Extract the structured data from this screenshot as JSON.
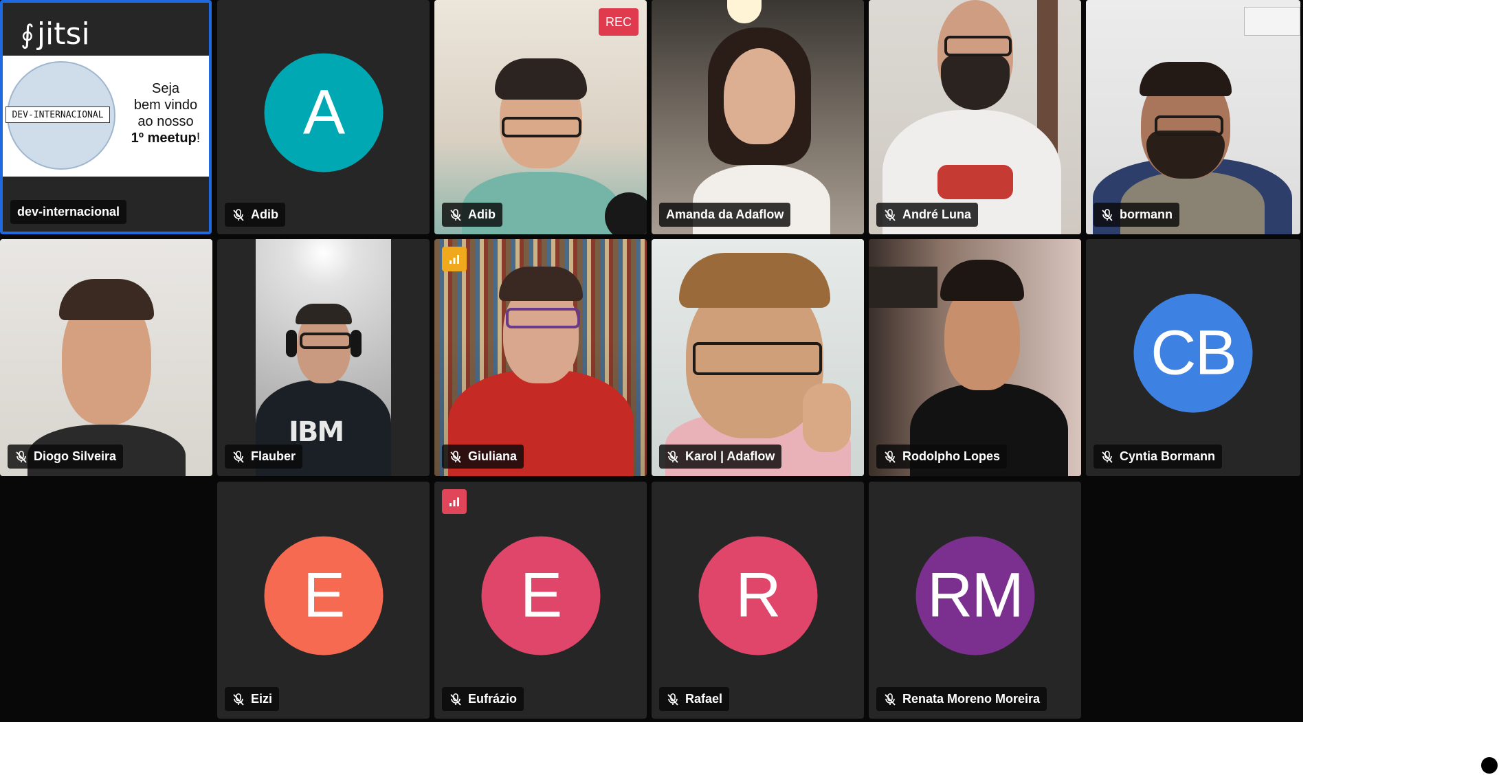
{
  "meeting": {
    "rec_label": "REC",
    "share": {
      "brand": "jitsi",
      "slide_logo_text": "DEV-INTERNACIONAL",
      "welcome_line1": "Seja",
      "welcome_line2": "bem vindo",
      "welcome_line3": "ao nosso",
      "welcome_bold": "1º meetup",
      "welcome_end": "!"
    },
    "participants": [
      {
        "name": "dev-internacional",
        "muted": false,
        "type": "share"
      },
      {
        "name": "Adib",
        "muted": true,
        "type": "avatar",
        "initials": "A",
        "color": "#00a8b3"
      },
      {
        "name": "Adib",
        "muted": true,
        "type": "video"
      },
      {
        "name": "Amanda da Adaflow",
        "muted": false,
        "type": "video"
      },
      {
        "name": "André Luna",
        "muted": true,
        "type": "video"
      },
      {
        "name": "bormann",
        "muted": true,
        "type": "video"
      },
      {
        "name": "Diogo Silveira",
        "muted": true,
        "type": "video"
      },
      {
        "name": "Flauber",
        "muted": true,
        "type": "video"
      },
      {
        "name": "Giuliana",
        "muted": true,
        "type": "video",
        "connection": "yellow"
      },
      {
        "name": "Karol | Adaflow",
        "muted": true,
        "type": "video"
      },
      {
        "name": "Rodolpho Lopes",
        "muted": true,
        "type": "video"
      },
      {
        "name": "Cyntia Bormann",
        "muted": true,
        "type": "avatar",
        "initials": "CB",
        "color": "#3d82e2"
      },
      {
        "name": "Eizi",
        "muted": true,
        "type": "avatar",
        "initials": "E",
        "color": "#f76a52"
      },
      {
        "name": "Eufrázio",
        "muted": true,
        "type": "avatar",
        "initials": "E",
        "color": "#e0456a",
        "connection": "red"
      },
      {
        "name": "Rafael",
        "muted": true,
        "type": "avatar",
        "initials": "R",
        "color": "#e0456a"
      },
      {
        "name": "Renata Moreno Moreira",
        "muted": true,
        "type": "avatar",
        "initials": "RM",
        "color": "#7b2f8e"
      }
    ]
  },
  "colors": {
    "active_border": "#1f6ae0",
    "rec": "#e03a4e",
    "connection_yellow": "#f0a81c",
    "connection_red": "#e0455a"
  }
}
